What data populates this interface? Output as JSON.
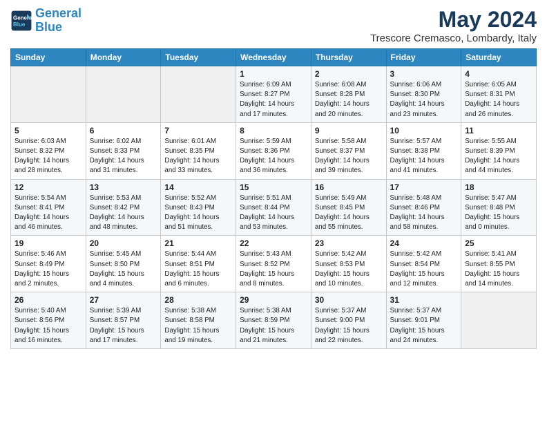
{
  "header": {
    "logo_line1": "General",
    "logo_line2": "Blue",
    "main_title": "May 2024",
    "subtitle": "Trescore Cremasco, Lombardy, Italy"
  },
  "days_of_week": [
    "Sunday",
    "Monday",
    "Tuesday",
    "Wednesday",
    "Thursday",
    "Friday",
    "Saturday"
  ],
  "weeks": [
    [
      {
        "day": "",
        "info": ""
      },
      {
        "day": "",
        "info": ""
      },
      {
        "day": "",
        "info": ""
      },
      {
        "day": "1",
        "info": "Sunrise: 6:09 AM\nSunset: 8:27 PM\nDaylight: 14 hours\nand 17 minutes."
      },
      {
        "day": "2",
        "info": "Sunrise: 6:08 AM\nSunset: 8:28 PM\nDaylight: 14 hours\nand 20 minutes."
      },
      {
        "day": "3",
        "info": "Sunrise: 6:06 AM\nSunset: 8:30 PM\nDaylight: 14 hours\nand 23 minutes."
      },
      {
        "day": "4",
        "info": "Sunrise: 6:05 AM\nSunset: 8:31 PM\nDaylight: 14 hours\nand 26 minutes."
      }
    ],
    [
      {
        "day": "5",
        "info": "Sunrise: 6:03 AM\nSunset: 8:32 PM\nDaylight: 14 hours\nand 28 minutes."
      },
      {
        "day": "6",
        "info": "Sunrise: 6:02 AM\nSunset: 8:33 PM\nDaylight: 14 hours\nand 31 minutes."
      },
      {
        "day": "7",
        "info": "Sunrise: 6:01 AM\nSunset: 8:35 PM\nDaylight: 14 hours\nand 33 minutes."
      },
      {
        "day": "8",
        "info": "Sunrise: 5:59 AM\nSunset: 8:36 PM\nDaylight: 14 hours\nand 36 minutes."
      },
      {
        "day": "9",
        "info": "Sunrise: 5:58 AM\nSunset: 8:37 PM\nDaylight: 14 hours\nand 39 minutes."
      },
      {
        "day": "10",
        "info": "Sunrise: 5:57 AM\nSunset: 8:38 PM\nDaylight: 14 hours\nand 41 minutes."
      },
      {
        "day": "11",
        "info": "Sunrise: 5:55 AM\nSunset: 8:39 PM\nDaylight: 14 hours\nand 44 minutes."
      }
    ],
    [
      {
        "day": "12",
        "info": "Sunrise: 5:54 AM\nSunset: 8:41 PM\nDaylight: 14 hours\nand 46 minutes."
      },
      {
        "day": "13",
        "info": "Sunrise: 5:53 AM\nSunset: 8:42 PM\nDaylight: 14 hours\nand 48 minutes."
      },
      {
        "day": "14",
        "info": "Sunrise: 5:52 AM\nSunset: 8:43 PM\nDaylight: 14 hours\nand 51 minutes."
      },
      {
        "day": "15",
        "info": "Sunrise: 5:51 AM\nSunset: 8:44 PM\nDaylight: 14 hours\nand 53 minutes."
      },
      {
        "day": "16",
        "info": "Sunrise: 5:49 AM\nSunset: 8:45 PM\nDaylight: 14 hours\nand 55 minutes."
      },
      {
        "day": "17",
        "info": "Sunrise: 5:48 AM\nSunset: 8:46 PM\nDaylight: 14 hours\nand 58 minutes."
      },
      {
        "day": "18",
        "info": "Sunrise: 5:47 AM\nSunset: 8:48 PM\nDaylight: 15 hours\nand 0 minutes."
      }
    ],
    [
      {
        "day": "19",
        "info": "Sunrise: 5:46 AM\nSunset: 8:49 PM\nDaylight: 15 hours\nand 2 minutes."
      },
      {
        "day": "20",
        "info": "Sunrise: 5:45 AM\nSunset: 8:50 PM\nDaylight: 15 hours\nand 4 minutes."
      },
      {
        "day": "21",
        "info": "Sunrise: 5:44 AM\nSunset: 8:51 PM\nDaylight: 15 hours\nand 6 minutes."
      },
      {
        "day": "22",
        "info": "Sunrise: 5:43 AM\nSunset: 8:52 PM\nDaylight: 15 hours\nand 8 minutes."
      },
      {
        "day": "23",
        "info": "Sunrise: 5:42 AM\nSunset: 8:53 PM\nDaylight: 15 hours\nand 10 minutes."
      },
      {
        "day": "24",
        "info": "Sunrise: 5:42 AM\nSunset: 8:54 PM\nDaylight: 15 hours\nand 12 minutes."
      },
      {
        "day": "25",
        "info": "Sunrise: 5:41 AM\nSunset: 8:55 PM\nDaylight: 15 hours\nand 14 minutes."
      }
    ],
    [
      {
        "day": "26",
        "info": "Sunrise: 5:40 AM\nSunset: 8:56 PM\nDaylight: 15 hours\nand 16 minutes."
      },
      {
        "day": "27",
        "info": "Sunrise: 5:39 AM\nSunset: 8:57 PM\nDaylight: 15 hours\nand 17 minutes."
      },
      {
        "day": "28",
        "info": "Sunrise: 5:38 AM\nSunset: 8:58 PM\nDaylight: 15 hours\nand 19 minutes."
      },
      {
        "day": "29",
        "info": "Sunrise: 5:38 AM\nSunset: 8:59 PM\nDaylight: 15 hours\nand 21 minutes."
      },
      {
        "day": "30",
        "info": "Sunrise: 5:37 AM\nSunset: 9:00 PM\nDaylight: 15 hours\nand 22 minutes."
      },
      {
        "day": "31",
        "info": "Sunrise: 5:37 AM\nSunset: 9:01 PM\nDaylight: 15 hours\nand 24 minutes."
      },
      {
        "day": "",
        "info": ""
      }
    ]
  ]
}
